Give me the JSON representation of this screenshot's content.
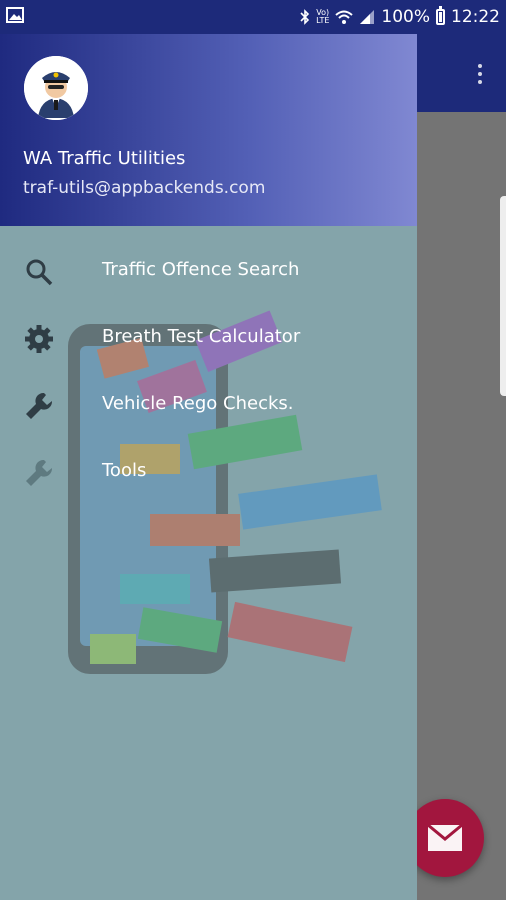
{
  "status_bar": {
    "battery": "100%",
    "time": "12:22",
    "network": "LTE"
  },
  "drawer": {
    "header": {
      "app_name": "WA Traffic Utilities",
      "email": "traf-utils@appbackends.com"
    },
    "items": [
      {
        "label": "Traffic Offence Search",
        "icon": "search-icon"
      },
      {
        "label": "Breath Test Calculator",
        "icon": "gear-icon"
      },
      {
        "label": "Vehicle Rego Checks.",
        "icon": "wrench-icon"
      },
      {
        "label": "Tools",
        "icon": "wrench-icon"
      }
    ]
  },
  "colors": {
    "primary": "#1d2a7a",
    "drawer_bg": "#84a4aa",
    "fab": "#a2163e"
  }
}
